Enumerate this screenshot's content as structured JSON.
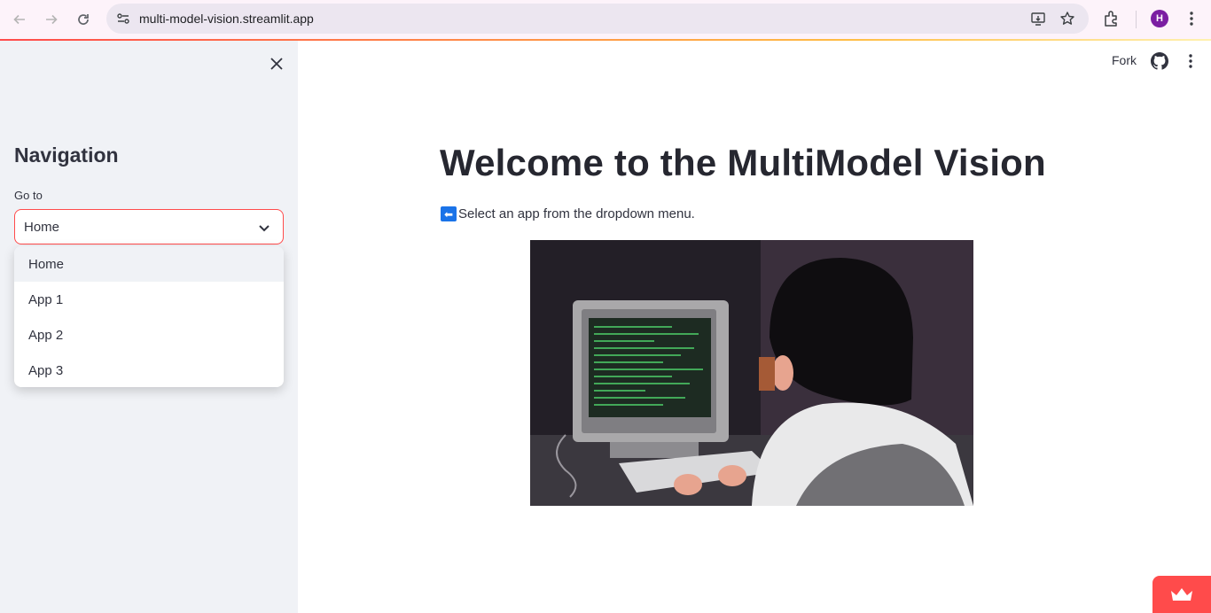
{
  "browser": {
    "url": "multi-model-vision.streamlit.app",
    "avatar_letter": "H"
  },
  "sidebar": {
    "title": "Navigation",
    "select_label": "Go to",
    "selected_value": "Home",
    "options": [
      "Home",
      "App 1",
      "App 2",
      "App 3"
    ]
  },
  "header": {
    "fork_label": "Fork"
  },
  "main": {
    "title": "Welcome to the MultiModel Vision",
    "subtitle": "Select an app from the dropdown menu.",
    "subtitle_icon": "left-arrow-emoji",
    "image": "programmer-at-retro-computer-illustration"
  },
  "colors": {
    "accent": "#ff4b4b",
    "sidebar_bg": "#f0f2f6",
    "text": "#31333f"
  }
}
